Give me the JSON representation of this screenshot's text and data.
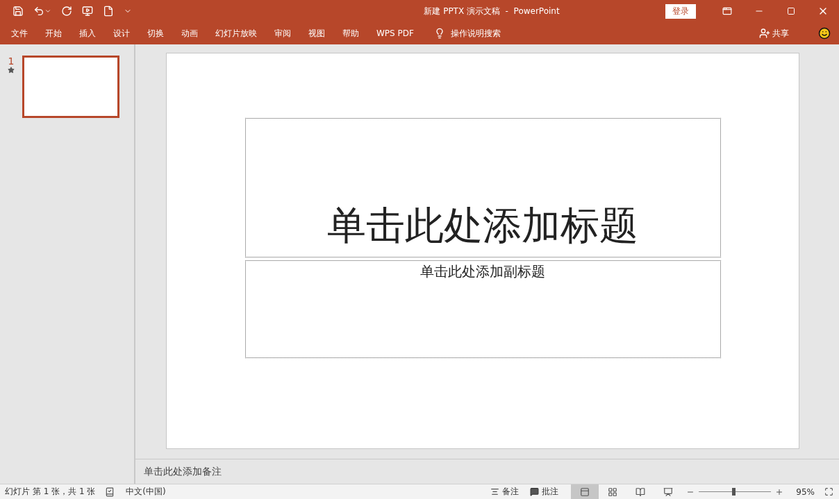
{
  "window": {
    "title": "新建 PPTX 演示文稿  -  PowerPoint",
    "login": "登录"
  },
  "ribbon_tabs": [
    {
      "label": "文件"
    },
    {
      "label": "开始"
    },
    {
      "label": "插入"
    },
    {
      "label": "设计"
    },
    {
      "label": "切换"
    },
    {
      "label": "动画"
    },
    {
      "label": "幻灯片放映"
    },
    {
      "label": "审阅"
    },
    {
      "label": "视图"
    },
    {
      "label": "帮助"
    },
    {
      "label": "WPS PDF"
    }
  ],
  "tell_me": "操作说明搜索",
  "share": "共享",
  "slides": [
    {
      "number": "1",
      "selected": true,
      "animated": true
    }
  ],
  "slide": {
    "title_placeholder": "单击此处添加标题",
    "subtitle_placeholder": "单击此处添加副标题"
  },
  "notes": {
    "placeholder": "单击此处添加备注"
  },
  "status_bar": {
    "slide_info": "幻灯片 第 1 张，共 1 张",
    "language": "中文(中国)",
    "notes_button": "备注",
    "comments_button": "批注",
    "views": [
      {
        "kind": "normal",
        "selected": true
      },
      {
        "kind": "sorter",
        "selected": false
      },
      {
        "kind": "reading",
        "selected": false
      },
      {
        "kind": "slideshow",
        "selected": false
      }
    ],
    "zoom": {
      "level": 0.48,
      "reading": "95%"
    }
  }
}
